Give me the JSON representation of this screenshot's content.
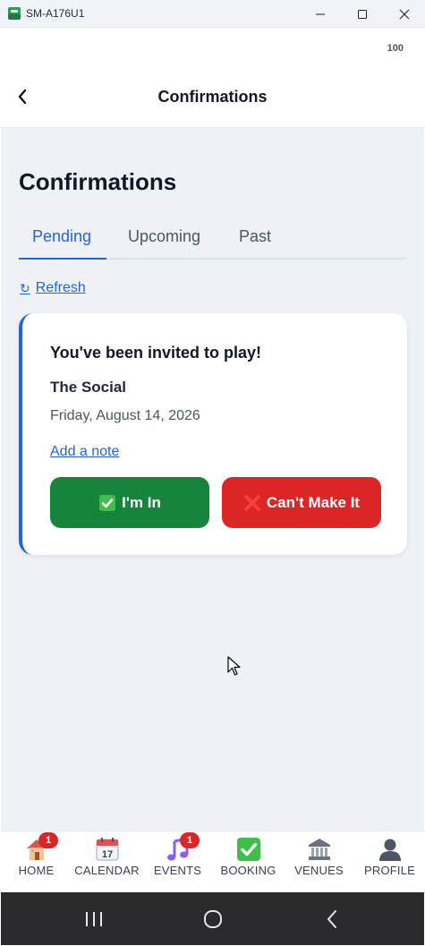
{
  "window": {
    "title": "SM-A176U1",
    "controls": [
      "minimize-icon",
      "maximize-icon",
      "close-icon"
    ]
  },
  "status_bar": {
    "battery": "100"
  },
  "appbar": {
    "title": "Confirmations",
    "back_icon": "chevron-left-icon"
  },
  "page": {
    "title": "Confirmations"
  },
  "tabs": [
    {
      "label": "Pending",
      "active": true
    },
    {
      "label": "Upcoming",
      "active": false
    },
    {
      "label": "Past",
      "active": false
    }
  ],
  "refresh": {
    "icon": "↻",
    "label": "Refresh"
  },
  "invitation": {
    "heading": "You've been invited to play!",
    "venue": "The Social",
    "date": "Friday, August 14, 2026",
    "note_link": "Add a note",
    "accept_label": "I'm In",
    "decline_label": "Can't Make It",
    "accent_color": "#2563d9",
    "accept_color": "#16843a",
    "decline_color": "#dc2626"
  },
  "bottom_nav": [
    {
      "label": "HOME",
      "icon": "house-icon",
      "badge": "1"
    },
    {
      "label": "CALENDAR",
      "icon": "calendar-icon",
      "badge": "",
      "calendar_day": "17"
    },
    {
      "label": "EVENTS",
      "icon": "music-note-icon",
      "badge": "1"
    },
    {
      "label": "BOOKING",
      "icon": "check-box-icon",
      "badge": ""
    },
    {
      "label": "VENUES",
      "icon": "building-columns-icon",
      "badge": ""
    },
    {
      "label": "PROFILE",
      "icon": "person-silhouette-icon",
      "badge": ""
    }
  ],
  "android_nav": [
    "recents-icon",
    "home-circle-icon",
    "back-icon"
  ]
}
